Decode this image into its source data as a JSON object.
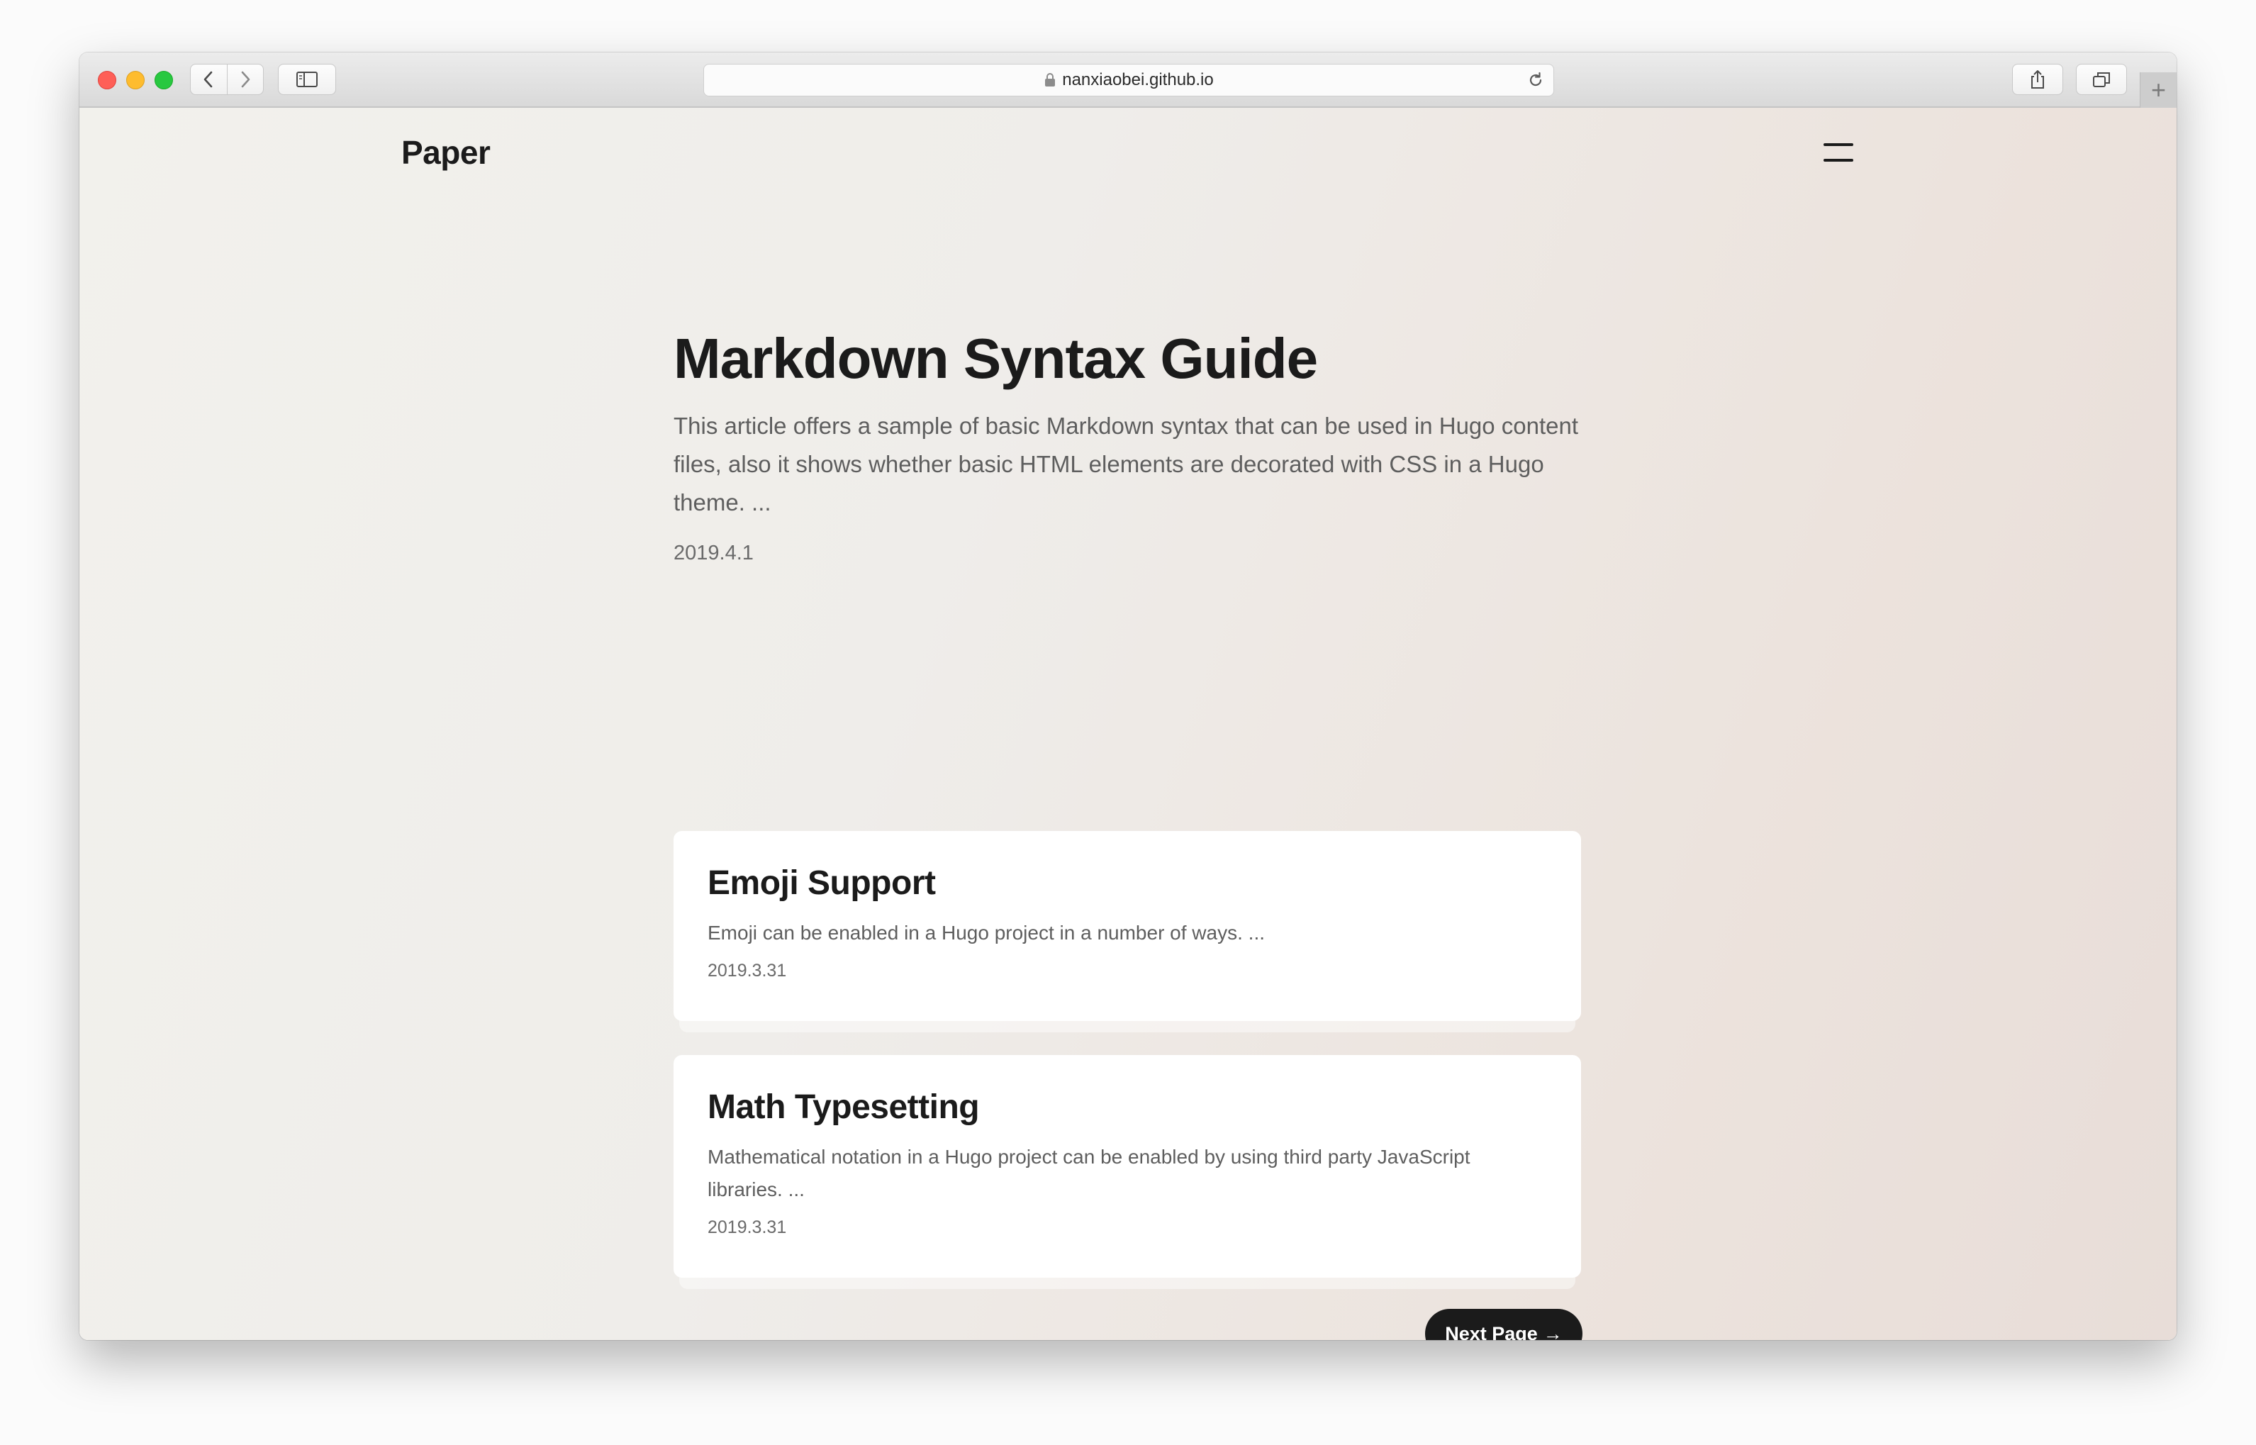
{
  "browser": {
    "url": "nanxiaobei.github.io",
    "lock_icon": "lock-icon",
    "reload_icon": "reload-icon",
    "back_icon": "chevron-left-icon",
    "forward_icon": "chevron-right-icon",
    "sidebar_icon": "sidebar-icon",
    "share_icon": "share-icon",
    "tabs_icon": "tabs-icon",
    "new_tab_label": "+"
  },
  "site": {
    "title": "Paper",
    "menu_icon": "menu-icon"
  },
  "hero": {
    "title": "Markdown Syntax Guide",
    "excerpt": "This article offers a sample of basic Markdown syntax that can be used in Hugo content files, also it shows whether basic HTML elements are decorated with CSS in a Hugo theme. ...",
    "date": "2019.4.1"
  },
  "posts": [
    {
      "title": "Emoji Support",
      "excerpt": "Emoji can be enabled in a Hugo project in a number of ways. ...",
      "date": "2019.3.31"
    },
    {
      "title": "Math Typesetting",
      "excerpt": "Mathematical notation in a Hugo project can be enabled by using third party JavaScript libraries. ...",
      "date": "2019.3.31"
    }
  ],
  "pagination": {
    "next_label": "Next Page",
    "next_arrow": "→"
  },
  "colors": {
    "accent": "#1b1b1b",
    "text_muted": "#5e5e5e",
    "close": "#fe5f57",
    "minimize": "#febc2e",
    "maximize": "#28c840"
  }
}
